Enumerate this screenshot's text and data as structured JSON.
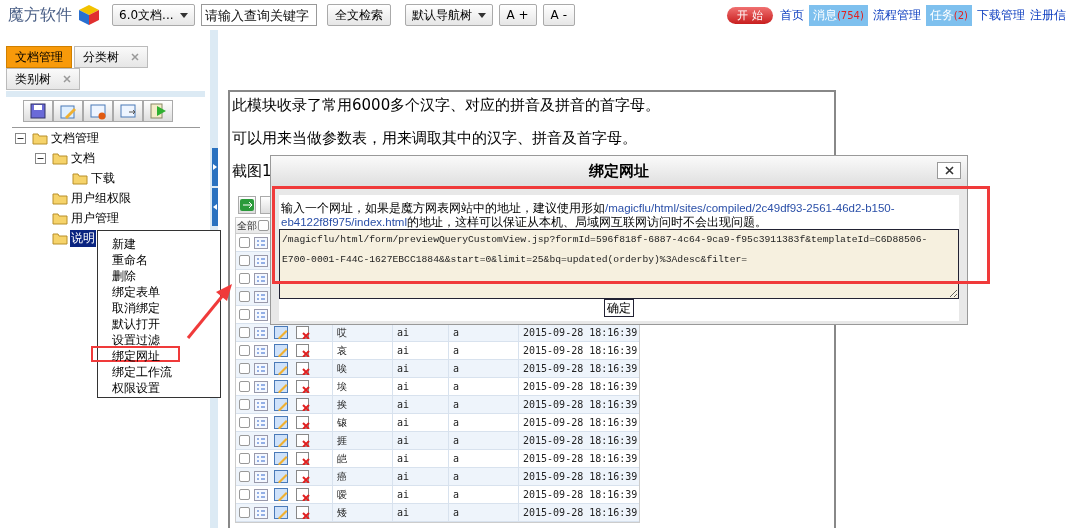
{
  "topbar": {
    "logo": "魔方软件",
    "version_select": "6.0文档...",
    "search": {
      "placeholder": "请输入查询关键字"
    },
    "search_button": "全文检索",
    "nav_select": "默认导航树",
    "font_buttons": [
      "A +",
      "A -"
    ],
    "links": [
      {
        "label": "开 始",
        "kind": "pill"
      },
      {
        "label": "首页",
        "kind": "link"
      },
      {
        "label": "消息",
        "count": "(754)",
        "kind": "badge"
      },
      {
        "label": "流程管理",
        "kind": "link"
      },
      {
        "label": "任务",
        "count": "(2)",
        "kind": "badge"
      },
      {
        "label": "下载管理",
        "kind": "link"
      },
      {
        "label": "注册信",
        "kind": "link"
      }
    ]
  },
  "sidebar": {
    "tabs": [
      {
        "label": "文档管理",
        "selected": true,
        "closable": false
      },
      {
        "label": "分类树",
        "selected": false,
        "closable": true
      },
      {
        "label": "类别树",
        "selected": false,
        "closable": true
      }
    ],
    "tree": [
      {
        "label": "文档管理",
        "expanded": true,
        "selected": false,
        "children": [
          {
            "label": "文档",
            "expanded": true,
            "selected": false,
            "children": [
              {
                "label": "下载",
                "selected": false
              }
            ]
          },
          {
            "label": "用户组权限",
            "selected": false
          },
          {
            "label": "用户管理",
            "selected": false
          },
          {
            "label": "说明",
            "selected": true
          }
        ]
      }
    ]
  },
  "context_menu": [
    {
      "label": "新建",
      "annotated": false
    },
    {
      "label": "重命名",
      "annotated": false
    },
    {
      "label": "删除",
      "annotated": false
    },
    {
      "label": "绑定表单",
      "annotated": false
    },
    {
      "label": "取消绑定",
      "annotated": false
    },
    {
      "label": "默认打开",
      "annotated": false
    },
    {
      "label": "设置过滤",
      "annotated": false
    },
    {
      "label": "绑定网址",
      "annotated": true
    },
    {
      "label": "绑定工作流",
      "annotated": false
    },
    {
      "label": "权限设置",
      "annotated": false
    }
  ],
  "content": {
    "paragraphs": [
      "此模块收录了常用6000多个汉字、对应的拼音及拼音的首字母。",
      "可以用来当做参数表，用来调取其中的汉字、拼音及首字母。",
      "截图1"
    ],
    "grid": {
      "select_all": {
        "label": "全部",
        "checked": false
      },
      "rows": [
        {
          "checked": false
        },
        {
          "checked": false
        },
        {
          "checked": false
        },
        {
          "checked": false
        },
        {
          "checked": false
        },
        {
          "checked": false,
          "char": "哎",
          "pinyin": "ai",
          "initial": "a",
          "time": "2015-09-28 18:16:39"
        },
        {
          "checked": false,
          "char": "哀",
          "pinyin": "ai",
          "initial": "a",
          "time": "2015-09-28 18:16:39"
        },
        {
          "checked": false,
          "char": "唉",
          "pinyin": "ai",
          "initial": "a",
          "time": "2015-09-28 18:16:39"
        },
        {
          "checked": false,
          "char": "埃",
          "pinyin": "ai",
          "initial": "a",
          "time": "2015-09-28 18:16:39"
        },
        {
          "checked": false,
          "char": "挨",
          "pinyin": "ai",
          "initial": "a",
          "time": "2015-09-28 18:16:39"
        },
        {
          "checked": false,
          "char": "锿",
          "pinyin": "ai",
          "initial": "a",
          "time": "2015-09-28 18:16:39"
        },
        {
          "checked": false,
          "char": "捱",
          "pinyin": "ai",
          "initial": "a",
          "time": "2015-09-28 18:16:39"
        },
        {
          "checked": false,
          "char": "皑",
          "pinyin": "ai",
          "initial": "a",
          "time": "2015-09-28 18:16:39"
        },
        {
          "checked": false,
          "char": "癌",
          "pinyin": "ai",
          "initial": "a",
          "time": "2015-09-28 18:16:39"
        },
        {
          "checked": false,
          "char": "嗳",
          "pinyin": "ai",
          "initial": "a",
          "time": "2015-09-28 18:16:39"
        },
        {
          "checked": false,
          "char": "矮",
          "pinyin": "ai",
          "initial": "a",
          "time": "2015-09-28 18:16:39"
        }
      ]
    }
  },
  "dialog": {
    "title": "绑定网址",
    "description": {
      "before": "输入一个网址，如果是魔方网表网站中的地址，建议使用形如",
      "path": "/magicflu/html/sites/compiled/2c49df93-2561-46d2-b150-eb4122f8f975/index.html",
      "after": "的地址，这样可以保证从本机、局域网互联网访问时不会出现问题。"
    },
    "url_value": "/magicflu/html/form/previewQueryCustomView.jsp?formId=596f818f-6887-4c64-9ca9-f95c3911383f&templateId=C6D88506-E700-0001-F44C-1627EBCC1884&&start=0&limit=25&bq=updated(orderby)%3Adesc&filter=",
    "ok_button": "确定"
  }
}
